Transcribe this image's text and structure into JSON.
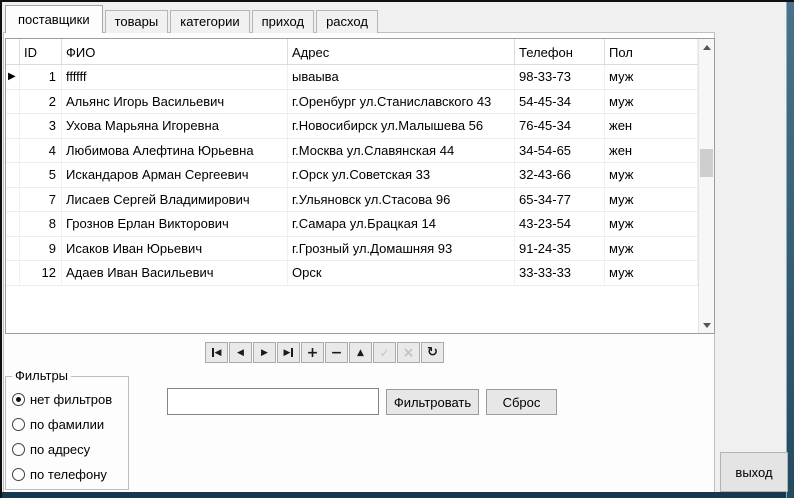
{
  "tabs": [
    {
      "label": "поставщики",
      "active": true
    },
    {
      "label": "товары",
      "active": false
    },
    {
      "label": "категории",
      "active": false
    },
    {
      "label": "приход",
      "active": false
    },
    {
      "label": "расход",
      "active": false
    }
  ],
  "grid": {
    "columns": [
      {
        "key": "id",
        "label": "ID"
      },
      {
        "key": "fio",
        "label": "ФИО"
      },
      {
        "key": "addr",
        "label": "Адрес"
      },
      {
        "key": "phone",
        "label": "Телефон"
      },
      {
        "key": "pol",
        "label": "Пол"
      }
    ],
    "rows": [
      {
        "id": "1",
        "fio": "ffffff",
        "addr": "ываыва",
        "phone": "98-33-73",
        "pol": "муж",
        "current": true
      },
      {
        "id": "2",
        "fio": "Альянс Игорь Васильевич",
        "addr": "г.Оренбург ул.Станиславского 43",
        "phone": "54-45-34",
        "pol": "муж",
        "current": false
      },
      {
        "id": "3",
        "fio": "Ухова Марьяна Игоревна",
        "addr": "г.Новосибирск ул.Малышева 56",
        "phone": "76-45-34",
        "pol": "жен",
        "current": false
      },
      {
        "id": "4",
        "fio": "Любимова Алефтина Юрьевна",
        "addr": "г.Москва ул.Славянская 44",
        "phone": "34-54-65",
        "pol": "жен",
        "current": false
      },
      {
        "id": "5",
        "fio": "Искандаров Арман Сергеевич",
        "addr": "г.Орск ул.Советская 33",
        "phone": "32-43-66",
        "pol": "муж",
        "current": false
      },
      {
        "id": "7",
        "fio": "Лисаев Сергей Владимирович",
        "addr": "г.Ульяновск ул.Стасова 96",
        "phone": "65-34-77",
        "pol": "муж",
        "current": false
      },
      {
        "id": "8",
        "fio": "Грознов Ерлан Викторович",
        "addr": "г.Самара ул.Брацкая 14",
        "phone": "43-23-54",
        "pol": "муж",
        "current": false
      },
      {
        "id": "9",
        "fio": "Исаков Иван Юрьевич",
        "addr": "г.Грозный ул.Домашняя 93",
        "phone": "91-24-35",
        "pol": "муж",
        "current": false
      },
      {
        "id": "12",
        "fio": "Адаев Иван Васильевич",
        "addr": "Орск",
        "phone": "33-33-33",
        "pol": "муж",
        "current": false
      }
    ]
  },
  "navigator": {
    "buttons": [
      {
        "name": "first",
        "enabled": true
      },
      {
        "name": "prior",
        "enabled": true
      },
      {
        "name": "next",
        "enabled": true
      },
      {
        "name": "last",
        "enabled": true
      },
      {
        "name": "insert",
        "enabled": true
      },
      {
        "name": "delete",
        "enabled": true
      },
      {
        "name": "edit",
        "enabled": true
      },
      {
        "name": "post",
        "enabled": false
      },
      {
        "name": "cancel",
        "enabled": false
      },
      {
        "name": "refresh",
        "enabled": true
      }
    ]
  },
  "filters": {
    "title": "Фильтры",
    "options": [
      {
        "label": "нет фильтров",
        "selected": true
      },
      {
        "label": "по фамилии",
        "selected": false
      },
      {
        "label": "по адресу",
        "selected": false
      },
      {
        "label": "по телефону",
        "selected": false
      }
    ],
    "input_value": "",
    "apply_label": "Фильтровать",
    "reset_label": "Сброс"
  },
  "exit_label": "выход",
  "colors": {
    "frame": "#2e5168",
    "form_bg": "#f0f0f0",
    "grid_bg": "#ffffff",
    "button_bg": "#e7e7e7"
  }
}
